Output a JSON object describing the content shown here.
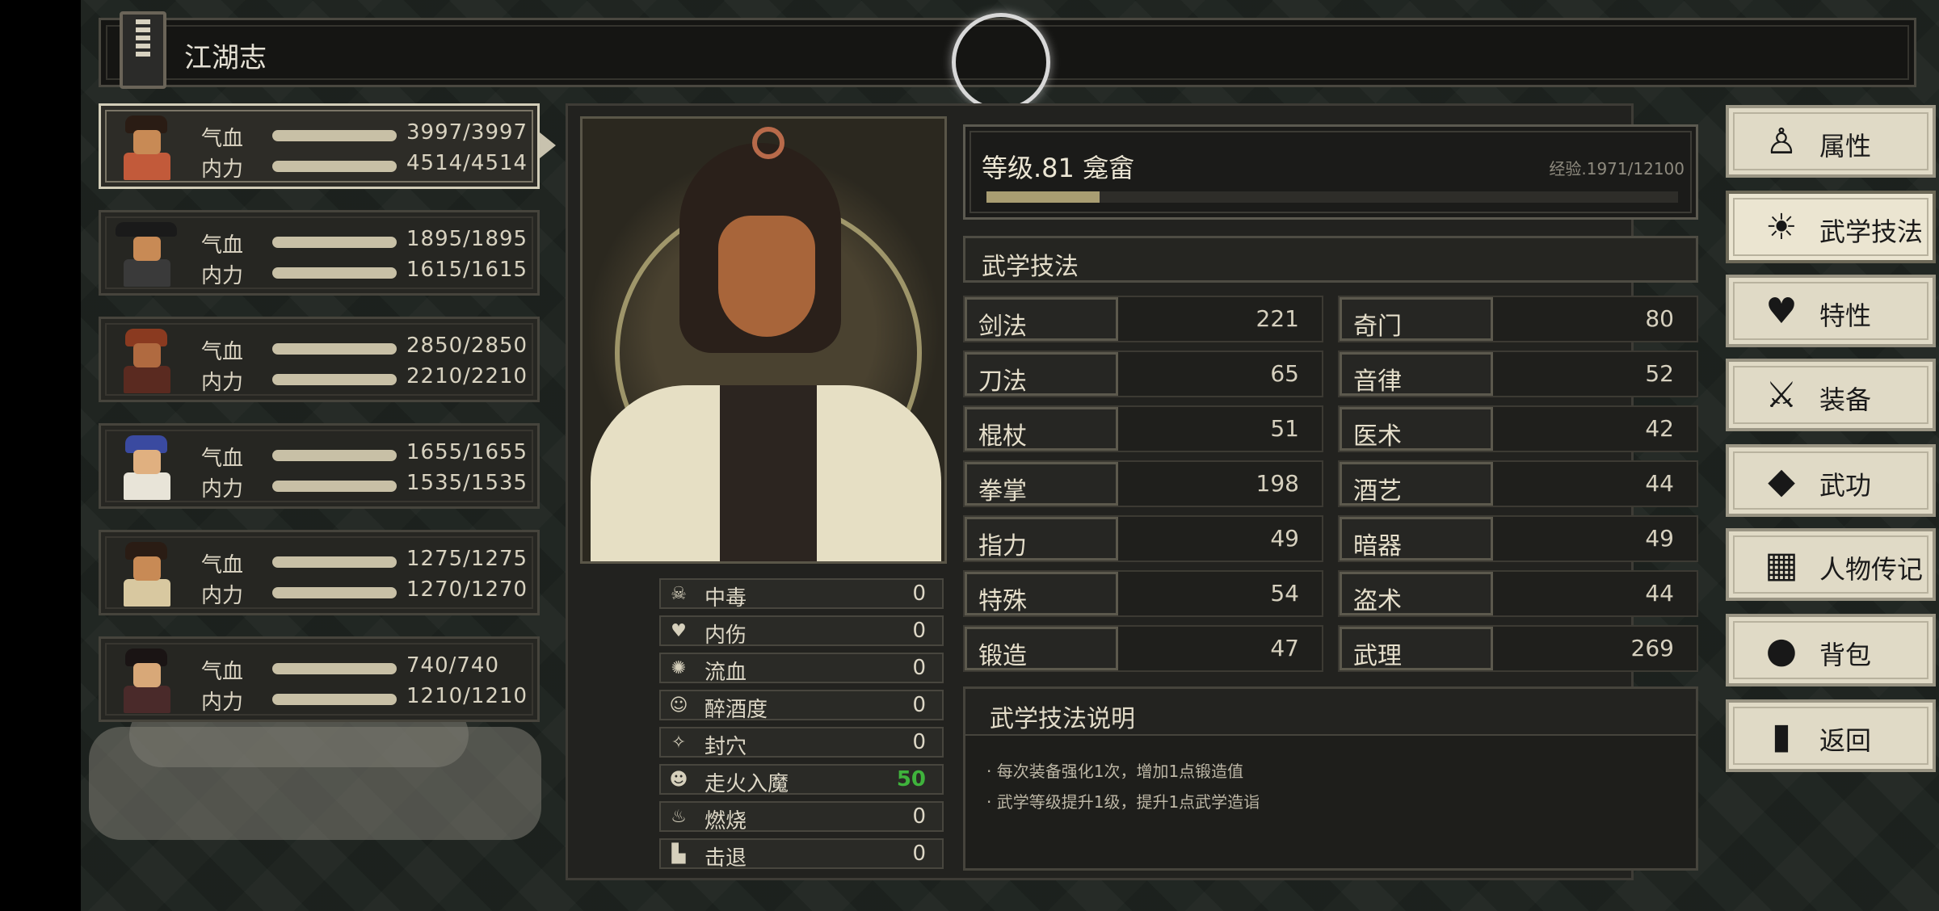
{
  "window_title": "江湖志",
  "party": [
    {
      "hp_label": "气血",
      "hp": "3997/3997",
      "mp_label": "内力",
      "mp": "4514/4514",
      "selected": true
    },
    {
      "hp_label": "气血",
      "hp": "1895/1895",
      "mp_label": "内力",
      "mp": "1615/1615",
      "selected": false
    },
    {
      "hp_label": "气血",
      "hp": "2850/2850",
      "mp_label": "内力",
      "mp": "2210/2210",
      "selected": false
    },
    {
      "hp_label": "气血",
      "hp": "1655/1655",
      "mp_label": "内力",
      "mp": "1535/1535",
      "selected": false
    },
    {
      "hp_label": "气血",
      "hp": "1275/1275",
      "mp_label": "内力",
      "mp": "1270/1270",
      "selected": false
    },
    {
      "hp_label": "气血",
      "hp": "740/740",
      "mp_label": "内力",
      "mp": "1210/1210",
      "selected": false
    }
  ],
  "status_effects": [
    {
      "icon": "skull-icon",
      "name": "中毒",
      "value": "0"
    },
    {
      "icon": "broken-heart-icon",
      "name": "内伤",
      "value": "0"
    },
    {
      "icon": "blood-drop-icon",
      "name": "流血",
      "value": "0"
    },
    {
      "icon": "drunk-face-icon",
      "name": "醉酒度",
      "value": "0"
    },
    {
      "icon": "acupoint-icon",
      "name": "封穴",
      "value": "0"
    },
    {
      "icon": "demon-face-icon",
      "name": "走火入魔",
      "value": "50"
    },
    {
      "icon": "flame-icon",
      "name": "燃烧",
      "value": "0"
    },
    {
      "icon": "boot-icon",
      "name": "击退",
      "value": "0"
    }
  ],
  "level": {
    "text": "等级.81 龛畲",
    "exp_text": "经验.1971/12100",
    "exp_fraction": 0.163
  },
  "skills_header": "武学技法",
  "skills": [
    {
      "name": "剑法",
      "value": "221"
    },
    {
      "name": "奇门",
      "value": "80"
    },
    {
      "name": "刀法",
      "value": "65"
    },
    {
      "name": "音律",
      "value": "52"
    },
    {
      "name": "棍杖",
      "value": "51"
    },
    {
      "name": "医术",
      "value": "42"
    },
    {
      "name": "拳掌",
      "value": "198"
    },
    {
      "name": "酒艺",
      "value": "44"
    },
    {
      "name": "指力",
      "value": "49"
    },
    {
      "name": "暗器",
      "value": "49"
    },
    {
      "name": "特殊",
      "value": "54"
    },
    {
      "name": "盗术",
      "value": "44"
    },
    {
      "name": "锻造",
      "value": "47"
    },
    {
      "name": "武理",
      "value": "269"
    }
  ],
  "description": {
    "title": "武学技法说明",
    "lines": [
      "· 每次装备强化1次，增加1点锻造值",
      "· 武学等级提升1级，提升1点武学造诣"
    ]
  },
  "menu": [
    {
      "icon": "person-icon",
      "label": "属性",
      "active": false
    },
    {
      "icon": "person-sparkle-icon",
      "label": "武学技法",
      "active": true
    },
    {
      "icon": "person-heart-icon",
      "label": "特性",
      "active": false
    },
    {
      "icon": "sword-icon",
      "label": "装备",
      "active": false
    },
    {
      "icon": "book-icon",
      "label": "武功",
      "active": false
    },
    {
      "icon": "scroll-icon",
      "label": "人物传记",
      "active": false
    },
    {
      "icon": "bag-icon",
      "label": "背包",
      "active": false
    },
    {
      "icon": "door-icon",
      "label": "返回",
      "active": false
    }
  ],
  "colors": {
    "highlight_value": "#3fb33c",
    "exp_fill": "#a99d72",
    "menu_bg": "#e0dac6"
  }
}
